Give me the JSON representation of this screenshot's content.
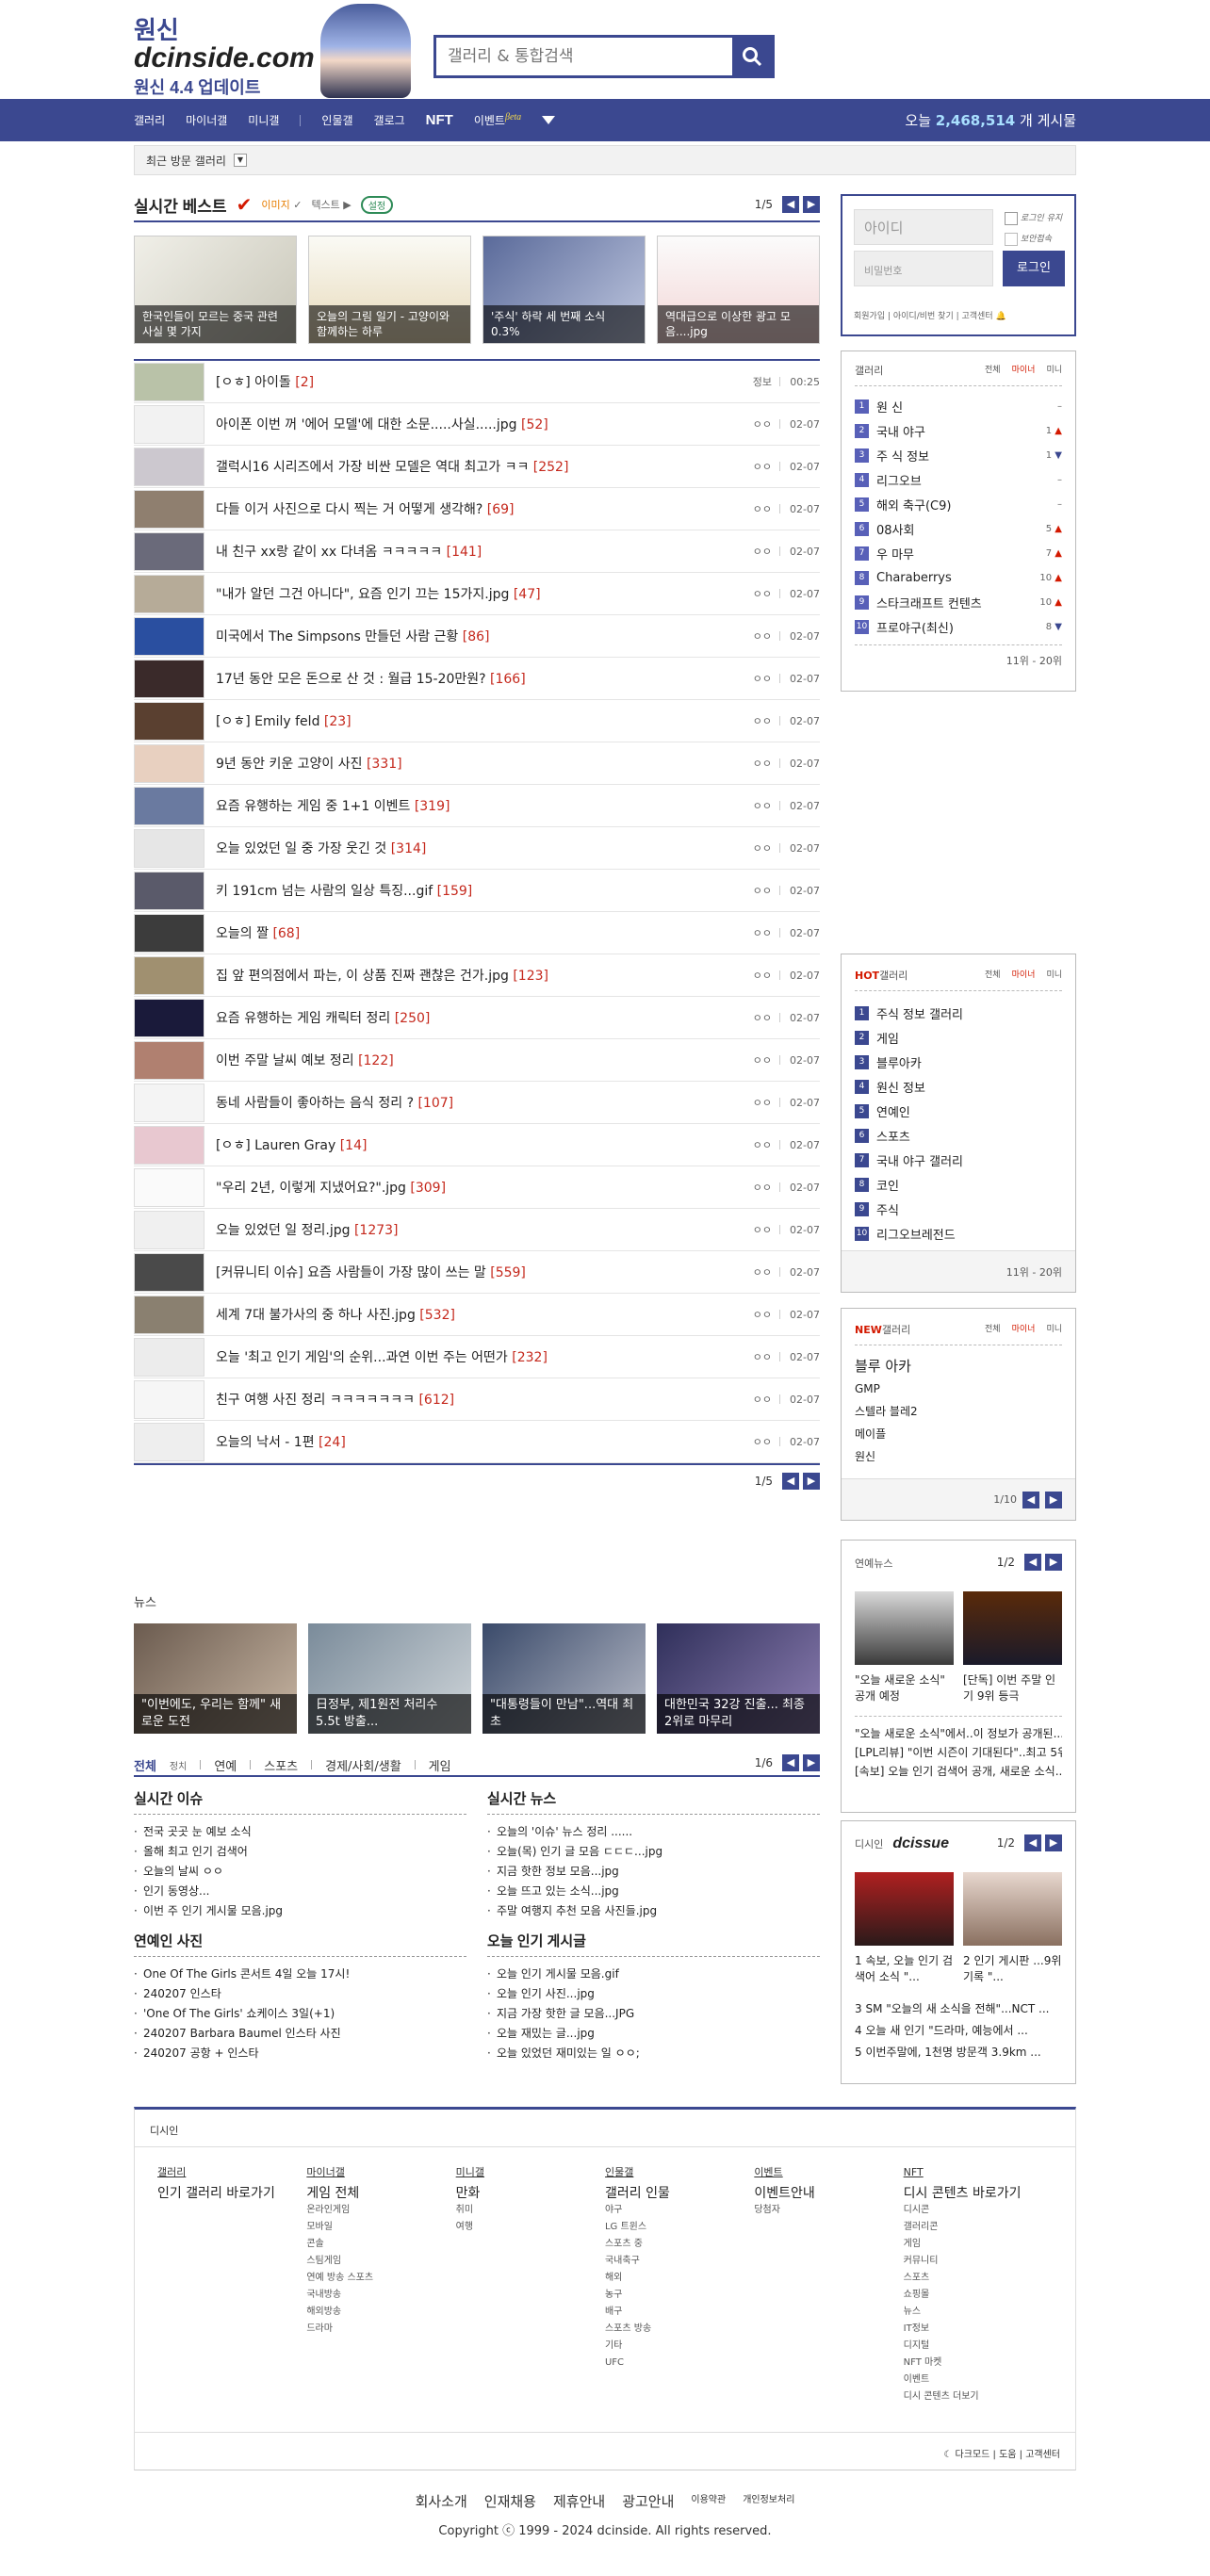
{
  "header": {
    "logo_top": "원신",
    "logo_main": "dcinside.com",
    "logo_sub": "원신 4.4 업데이트",
    "search_placeholder": "갤러리 & 통합검색"
  },
  "gnb": {
    "items": [
      "갤러리",
      "마이너갤",
      "미니갤",
      "인물갤",
      "갤로그",
      "NFT",
      "이벤트"
    ],
    "beta": "βeta",
    "stat_prefix": "오늘",
    "stat_value": "2,468,514",
    "stat_suffix": "개 게시물"
  },
  "subbar": {
    "label": "최근 방문 갤러리"
  },
  "best": {
    "title": "실시간 베스트",
    "opt1": "이미지",
    "opt2": "텍스트",
    "pill": "설정",
    "page": "1/5",
    "thumbs": [
      "한국인들이 모르는 중국 관련 사실 몇 가지",
      "오늘의 그림 일기 - 고양이와 함께하는 하루",
      "'주식' 하락 세 번째 소식 0.3%",
      "역대급으로 이상한 광고 모음....jpg"
    ],
    "rows": [
      {
        "title": "[ㅇㅎ] 아이돌",
        "count": "[2]",
        "name": "정보",
        "date": "00:25"
      },
      {
        "title": "아이폰 이번 꺼 '에어 모델'에 대한 소문.....사실.....jpg",
        "count": "[52]",
        "name": "ㅇㅇ",
        "date": "02-07"
      },
      {
        "title": "갤럭시16 시리즈에서 가장 비싼 모델은 역대 최고가 ㅋㅋ",
        "count": "[252]",
        "name": "ㅇㅇ",
        "date": "02-07"
      },
      {
        "title": "다들 이거 사진으로 다시 찍는 거 어떻게 생각해?",
        "count": "[69]",
        "name": "ㅇㅇ",
        "date": "02-07"
      },
      {
        "title": "내 친구 xx랑 같이 xx 다녀옴 ㅋㅋㅋㅋㅋ",
        "count": "[141]",
        "name": "ㅇㅇ",
        "date": "02-07"
      },
      {
        "title": "\"내가 알던 그건 아니다\", 요즘 인기 끄는 15가지.jpg",
        "count": "[47]",
        "name": "ㅇㅇ",
        "date": "02-07"
      },
      {
        "title": "미국에서 The Simpsons 만들던 사람 근황",
        "count": "[86]",
        "name": "ㅇㅇ",
        "date": "02-07"
      },
      {
        "title": "17년 동안 모은 돈으로 산 것 : 월급 15-20만원?",
        "count": "[166]",
        "name": "ㅇㅇ",
        "date": "02-07"
      },
      {
        "title": "[ㅇㅎ] Emily feld",
        "count": "[23]",
        "name": "ㅇㅇ",
        "date": "02-07"
      },
      {
        "title": "9년 동안 키운 고양이 사진",
        "count": "[331]",
        "name": "ㅇㅇ",
        "date": "02-07"
      },
      {
        "title": "요즘 유행하는 게임 중 1+1 이벤트",
        "count": "[319]",
        "name": "ㅇㅇ",
        "date": "02-07"
      },
      {
        "title": "오늘 있었던 일 중 가장 웃긴 것",
        "count": "[314]",
        "name": "ㅇㅇ",
        "date": "02-07"
      },
      {
        "title": "키 191cm 넘는 사람의 일상 특징...gif",
        "count": "[159]",
        "name": "ㅇㅇ",
        "date": "02-07"
      },
      {
        "title": "오늘의 짤",
        "count": "[68]",
        "name": "ㅇㅇ",
        "date": "02-07"
      },
      {
        "title": "집 앞 편의점에서 파는, 이 상품 진짜 괜찮은 건가.jpg",
        "count": "[123]",
        "name": "ㅇㅇ",
        "date": "02-07"
      },
      {
        "title": "요즘 유행하는 게임 캐릭터 정리",
        "count": "[250]",
        "name": "ㅇㅇ",
        "date": "02-07"
      },
      {
        "title": "이번 주말 날씨 예보 정리",
        "count": "[122]",
        "name": "ㅇㅇ",
        "date": "02-07"
      },
      {
        "title": "동네 사람들이 좋아하는 음식 정리 ?",
        "count": "[107]",
        "name": "ㅇㅇ",
        "date": "02-07"
      },
      {
        "title": "[ㅇㅎ] Lauren Gray",
        "count": "[14]",
        "name": "ㅇㅇ",
        "date": "02-07"
      },
      {
        "title": "\"우리 2년, 이렇게 지냈어요?\".jpg",
        "count": "[309]",
        "name": "ㅇㅇ",
        "date": "02-07"
      },
      {
        "title": "오늘 있었던 일 정리.jpg",
        "count": "[1273]",
        "name": "ㅇㅇ",
        "date": "02-07"
      },
      {
        "title": "[커뮤니티 이슈] 요즘 사람들이 가장 많이 쓰는 말",
        "count": "[559]",
        "name": "ㅇㅇ",
        "date": "02-07"
      },
      {
        "title": "세계 7대 불가사의 중 하나 사진.jpg",
        "count": "[532]",
        "name": "ㅇㅇ",
        "date": "02-07"
      },
      {
        "title": "오늘 '최고 인기 게임'의 순위...과연 이번 주는 어떤가",
        "count": "[232]",
        "name": "ㅇㅇ",
        "date": "02-07"
      },
      {
        "title": "친구 여행 사진 정리 ㅋㅋㅋㅋㅋㅋㅋ",
        "count": "[612]",
        "name": "ㅇㅇ",
        "date": "02-07"
      },
      {
        "title": "오늘의 낙서 - 1편",
        "count": "[24]",
        "name": "ㅇㅇ",
        "date": "02-07"
      }
    ],
    "foot_page": "1/5"
  },
  "news": {
    "label": "뉴스",
    "thumbs": [
      "\"이번에도, 우리는 함께\" 새로운 도전",
      "日정부, 제1원전 처리수 5.5t 방출...",
      "\"대통령들이 만남\"...역대 최초",
      "대한민국 32강 진출... 최종 2위로 마무리"
    ],
    "tabs": [
      "전체",
      "연예",
      "스포츠",
      "경제/사회/생활",
      "게임"
    ],
    "small_tab": "정치",
    "page": "1/6",
    "col1_h": "실시간 이슈",
    "col1": [
      "전국 곳곳 눈 예보 소식",
      "올해 최고 인기 검색어",
      "오늘의 날씨 ㅇㅇ",
      "인기 동영상...",
      "이번 주 인기 게시물 모음.jpg"
    ],
    "col2_h": "실시간 뉴스",
    "col2": [
      "오늘의 '이슈' 뉴스 정리 ......",
      "오늘(목) 인기 글 모음 ㄷㄷㄷ...jpg",
      "지금 핫한 정보 모음...jpg",
      "오늘 뜨고 있는 소식...jpg",
      "주말 여행지 추천 모음 사진들.jpg"
    ],
    "col3_h": "연예인 사진",
    "col3": [
      "One Of The Girls 콘서트 4일 오늘 17시!",
      "240207 인스타",
      "'One Of The Girls' 쇼케이스 3일(+1)",
      "240207 Barbara Baumel 인스타 사진",
      "240207 공항 + 인스타"
    ],
    "col4_h": "오늘 인기 게시글",
    "col4": [
      "오늘 인기 게시물 모음.gif",
      "오늘 인기 사진...jpg",
      "지금 가장 핫한 글 모음...JPG",
      "오늘 재밌는 글...jpg",
      "오늘 있었던 재미있는 일 ㅇㅇ;"
    ]
  },
  "login": {
    "id_placeholder": "아이디",
    "pw_placeholder": "비밀번호",
    "keep": "로그인 유지",
    "secure": "보안접속",
    "button": "로그인",
    "links": "회원가입 | 아이디/비번 찾기 | 고객센터"
  },
  "rank": {
    "title": "갤러리",
    "tabs": [
      "전체",
      "마이너",
      "미니"
    ],
    "items": [
      {
        "n": "1",
        "label": "원 신",
        "change": "–",
        "dir": "none"
      },
      {
        "n": "2",
        "label": "국내 야구",
        "change": "1",
        "dir": "up"
      },
      {
        "n": "3",
        "label": "주 식 정보",
        "change": "1",
        "dir": "down"
      },
      {
        "n": "4",
        "label": "리그오브",
        "change": "–",
        "dir": "none"
      },
      {
        "n": "5",
        "label": "해외 축구(C9)",
        "change": "–",
        "dir": "none"
      },
      {
        "n": "6",
        "label": "08사회",
        "change": "5",
        "dir": "up"
      },
      {
        "n": "7",
        "label": "우 마무",
        "change": "7",
        "dir": "up"
      },
      {
        "n": "8",
        "label": "Charaberrys",
        "change": "10",
        "dir": "up"
      },
      {
        "n": "9",
        "label": "스타크래프트 컨텐츠",
        "change": "10",
        "dir": "up"
      },
      {
        "n": "10",
        "label": "프로야구(최신)",
        "change": "8",
        "dir": "down"
      }
    ],
    "more": "11위 - 20위"
  },
  "hot": {
    "title_hot": "HOT",
    "title_rest": "갤러리",
    "tabs": [
      "전체",
      "마이너",
      "미니"
    ],
    "items": [
      "주식 정보 갤러리",
      "게임",
      "블루아카",
      "원신 정보",
      "연예인",
      "스포츠",
      "국내 야구 갤러리",
      "코인",
      "주식",
      "리그오브레전드"
    ],
    "nums": [
      "1",
      "2",
      "3",
      "4",
      "5",
      "6",
      "7",
      "8",
      "9",
      "10"
    ],
    "more": "11위 - 20위"
  },
  "newg": {
    "title_new": "NEW",
    "title_rest": "갤러리",
    "tabs": [
      "전체",
      "마이너",
      "미니"
    ],
    "items": [
      "블루 아카",
      "GMP",
      "스텔라 블레2",
      "메이플",
      "원신"
    ],
    "page": "1/10"
  },
  "rboard": {
    "title": "연예뉴스",
    "page": "1/2",
    "caps": [
      "\"오늘 새로운 소식\" 공개 예정",
      "[단독] 이번 주말 인기 9위 등극"
    ],
    "lines": [
      "\"오늘 새로운 소식\"에서..이 정보가 공개된...",
      "[LPL리뷰] \"이번 시즌이 기대된다\"..최고 5위...",
      "[속보] 오늘 인기 검색어 공개, 새로운 소식..."
    ]
  },
  "issue": {
    "prefix": "디시인",
    "logo": "dcissue",
    "page": "1/2",
    "caps": [
      "1 속보, 오늘 인기 검색어 소식 \"...",
      "2 인기 게시판 ...9위 기록 \"..."
    ],
    "lines": [
      "3 SM \"오늘의 새 소식을 전해\"...NCT ...",
      "4 오늘 새 인기 \"드라마, 예능에서 ...",
      "5 이번주말에, 1천명 방문객 3.9km ..."
    ]
  },
  "footer": {
    "head": "디시인",
    "cols": [
      {
        "h": "갤러리",
        "items": [
          "인기 갤러리 바로가기"
        ]
      },
      {
        "h": "마이너갤",
        "items": [
          "게임 전체",
          "온라인게임",
          "모바일",
          "콘솔",
          "스팀게임",
          "연예 방송 스포츠",
          "국내방송",
          "해외방송",
          "드라마"
        ]
      },
      {
        "h": "미니갤",
        "items": [
          "만화",
          "취미",
          "여행"
        ]
      },
      {
        "h": "인물갤",
        "items": [
          "갤러리 인물",
          "야구",
          "LG 트윈스",
          "스포츠 중",
          "국내축구",
          "해외",
          "농구",
          "배구",
          "스포츠 방송",
          "기타",
          "UFC"
        ]
      },
      {
        "h": "이벤트",
        "items": [
          "이벤트안내",
          "당첨자"
        ]
      },
      {
        "h": "NFT",
        "items": [
          "디시 콘텐츠 바로가기",
          "디시콘",
          "갤러리콘",
          "게임",
          "커뮤니티",
          "스포츠",
          "쇼핑몰",
          "뉴스",
          "IT정보",
          "디지털",
          "NFT 마켓",
          "이벤트",
          "디시 콘텐츠 더보기"
        ]
      }
    ],
    "bottom": "다크모드  |  도움  |  고객센터",
    "links": [
      "회사소개",
      "인재채용",
      "제휴안내",
      "광고안내",
      "이용약관",
      "개인정보처리"
    ],
    "copyright": "Copyright ⓒ 1999 - 2024 dcinside. All rights reserved."
  },
  "colors": {
    "brand": "#3b4890",
    "accent": "#d31900",
    "comment": "#c5281c"
  }
}
